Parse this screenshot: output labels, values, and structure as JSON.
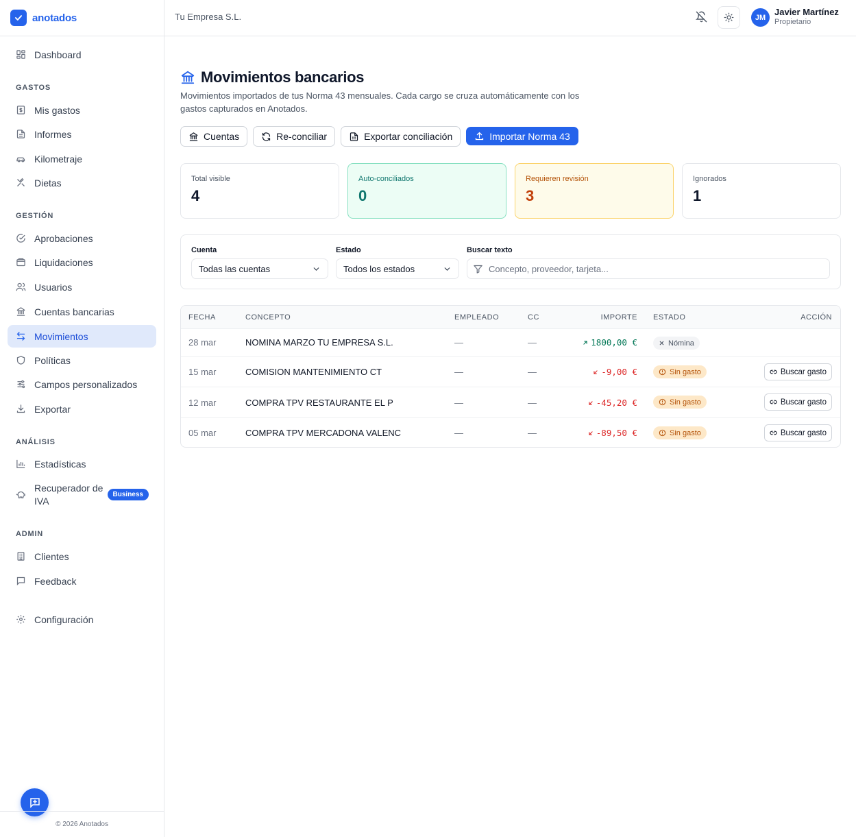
{
  "brand": {
    "name": "anotados"
  },
  "header": {
    "company": "Tu Empresa S.L.",
    "user": {
      "initials": "JM",
      "name": "Javier Martínez",
      "role": "Propietario"
    }
  },
  "sidebar": {
    "dashboard": "Dashboard",
    "sections": {
      "gastos": "GASTOS",
      "gestion": "GESTIÓN",
      "analisis": "ANÁLISIS",
      "admin": "ADMIN"
    },
    "items": {
      "mis_gastos": "Mis gastos",
      "informes": "Informes",
      "kilometraje": "Kilometraje",
      "dietas": "Dietas",
      "aprobaciones": "Aprobaciones",
      "liquidaciones": "Liquidaciones",
      "usuarios": "Usuarios",
      "cuentas_bancarias": "Cuentas bancarias",
      "movimientos": "Movimientos",
      "politicas": "Políticas",
      "campos_personalizados": "Campos personalizados",
      "exportar": "Exportar",
      "estadisticas": "Estadísticas",
      "recuperador_iva": "Recuperador de IVA",
      "recuperador_badge": "Business",
      "clientes": "Clientes",
      "feedback": "Feedback",
      "configuracion": "Configuración"
    },
    "footer": "© 2026 Anotados"
  },
  "page": {
    "title": "Movimientos bancarios",
    "description": "Movimientos importados de tus Norma 43 mensuales. Cada cargo se cruza automáticamente con los gastos capturados en Anotados.",
    "actions": {
      "cuentas": "Cuentas",
      "reconciliar": "Re-conciliar",
      "exportar": "Exportar conciliación",
      "importar": "Importar Norma 43"
    }
  },
  "stats": {
    "total": {
      "label": "Total visible",
      "value": "4"
    },
    "auto": {
      "label": "Auto-conciliados",
      "value": "0"
    },
    "review": {
      "label": "Requieren revisión",
      "value": "3"
    },
    "ignored": {
      "label": "Ignorados",
      "value": "1"
    }
  },
  "filters": {
    "cuenta": {
      "label": "Cuenta",
      "value": "Todas las cuentas"
    },
    "estado": {
      "label": "Estado",
      "value": "Todos los estados"
    },
    "buscar": {
      "label": "Buscar texto",
      "placeholder": "Concepto, proveedor, tarjeta..."
    }
  },
  "table": {
    "headers": {
      "fecha": "FECHA",
      "concepto": "CONCEPTO",
      "empleado": "EMPLEADO",
      "cc": "CC",
      "importe": "IMPORTE",
      "estado": "ESTADO",
      "accion": "ACCIÓN"
    },
    "rows": [
      {
        "fecha": "28 mar",
        "concepto": "NOMINA MARZO TU EMPRESA S.L.",
        "empleado": "—",
        "cc": "—",
        "importe": "1800,00 €",
        "estado": "Nómina",
        "accion": ""
      },
      {
        "fecha": "15 mar",
        "concepto": "COMISION MANTENIMIENTO CT",
        "empleado": "—",
        "cc": "—",
        "importe": "-9,00 €",
        "estado": "Sin gasto",
        "accion": "Buscar gasto"
      },
      {
        "fecha": "12 mar",
        "concepto": "COMPRA TPV RESTAURANTE EL P",
        "empleado": "—",
        "cc": "—",
        "importe": "-45,20 €",
        "estado": "Sin gasto",
        "accion": "Buscar gasto"
      },
      {
        "fecha": "05 mar",
        "concepto": "COMPRA TPV MERCADONA VALENC",
        "empleado": "—",
        "cc": "—",
        "importe": "-89,50 €",
        "estado": "Sin gasto",
        "accion": "Buscar gasto"
      }
    ]
  },
  "colors": {
    "accent": "#2563eb",
    "positive": "#047857",
    "negative": "#dc2626",
    "warning": "#b45309"
  }
}
